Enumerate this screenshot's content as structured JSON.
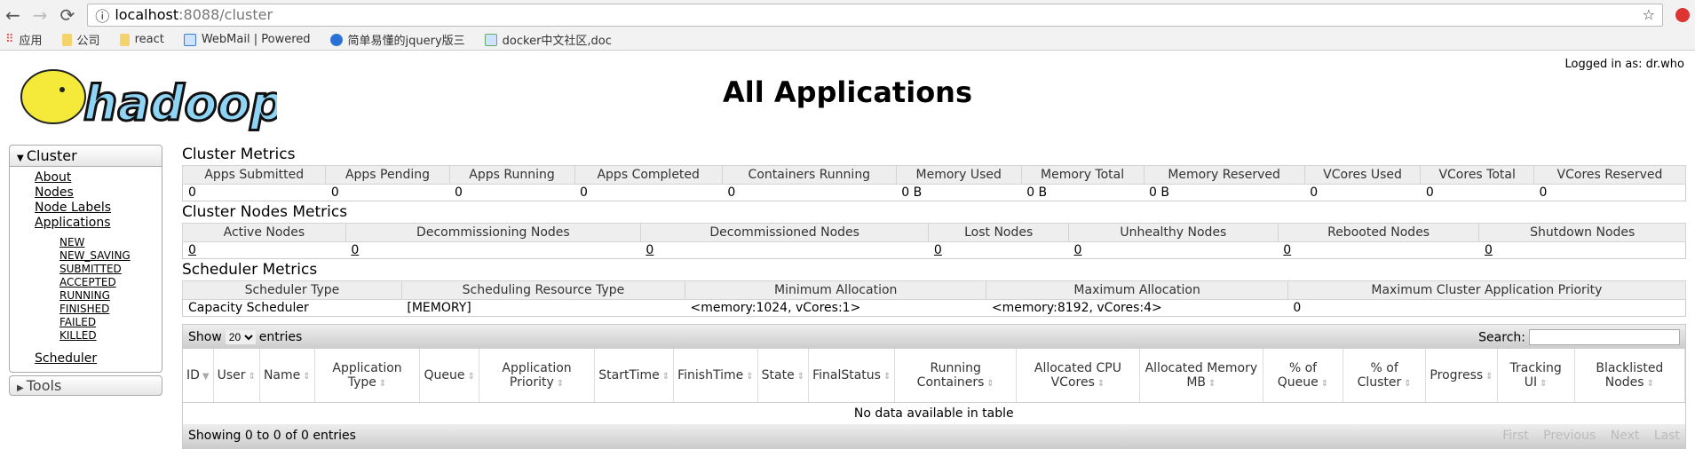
{
  "browser": {
    "url_host": "localhost",
    "url_rest": ":8088/cluster",
    "bookmarks": [
      "应用",
      "公司",
      "react",
      "WebMail | Powered",
      "简单易懂的jquery版三",
      "docker中文社区,doc"
    ]
  },
  "header": {
    "logo_text": "hadoop",
    "title": "All Applications",
    "logged_in": "Logged in as: dr.who"
  },
  "sidebar": {
    "cluster_label": "Cluster",
    "items": [
      "About",
      "Nodes",
      "Node Labels",
      "Applications"
    ],
    "app_states": [
      "NEW",
      "NEW_SAVING",
      "SUBMITTED",
      "ACCEPTED",
      "RUNNING",
      "FINISHED",
      "FAILED",
      "KILLED"
    ],
    "scheduler": "Scheduler",
    "tools_label": "Tools"
  },
  "cluster_metrics": {
    "title": "Cluster Metrics",
    "headers": [
      "Apps Submitted",
      "Apps Pending",
      "Apps Running",
      "Apps Completed",
      "Containers Running",
      "Memory Used",
      "Memory Total",
      "Memory Reserved",
      "VCores Used",
      "VCores Total",
      "VCores Reserved"
    ],
    "values": [
      "0",
      "0",
      "0",
      "0",
      "0",
      "0 B",
      "0 B",
      "0 B",
      "0",
      "0",
      "0"
    ]
  },
  "node_metrics": {
    "title": "Cluster Nodes Metrics",
    "headers": [
      "Active Nodes",
      "Decommissioning Nodes",
      "Decommissioned Nodes",
      "Lost Nodes",
      "Unhealthy Nodes",
      "Rebooted Nodes",
      "Shutdown Nodes"
    ],
    "values": [
      "0",
      "0",
      "0",
      "0",
      "0",
      "0",
      "0"
    ]
  },
  "scheduler_metrics": {
    "title": "Scheduler Metrics",
    "headers": [
      "Scheduler Type",
      "Scheduling Resource Type",
      "Minimum Allocation",
      "Maximum Allocation",
      "Maximum Cluster Application Priority"
    ],
    "values": [
      "Capacity Scheduler",
      "[MEMORY]",
      "<memory:1024, vCores:1>",
      "<memory:8192, vCores:4>",
      "0"
    ]
  },
  "apps_table": {
    "show": "Show",
    "entries_value": "20",
    "entries": "entries",
    "search": "Search:",
    "columns": [
      "ID",
      "User",
      "Name",
      "Application Type",
      "Queue",
      "Application Priority",
      "StartTime",
      "FinishTime",
      "State",
      "FinalStatus",
      "Running Containers",
      "Allocated CPU VCores",
      "Allocated Memory MB",
      "% of Queue",
      "% of Cluster",
      "Progress",
      "Tracking UI",
      "Blacklisted Nodes"
    ],
    "empty": "No data available in table",
    "info": "Showing 0 to 0 of 0 entries",
    "paging": [
      "First",
      "Previous",
      "Next",
      "Last"
    ]
  }
}
